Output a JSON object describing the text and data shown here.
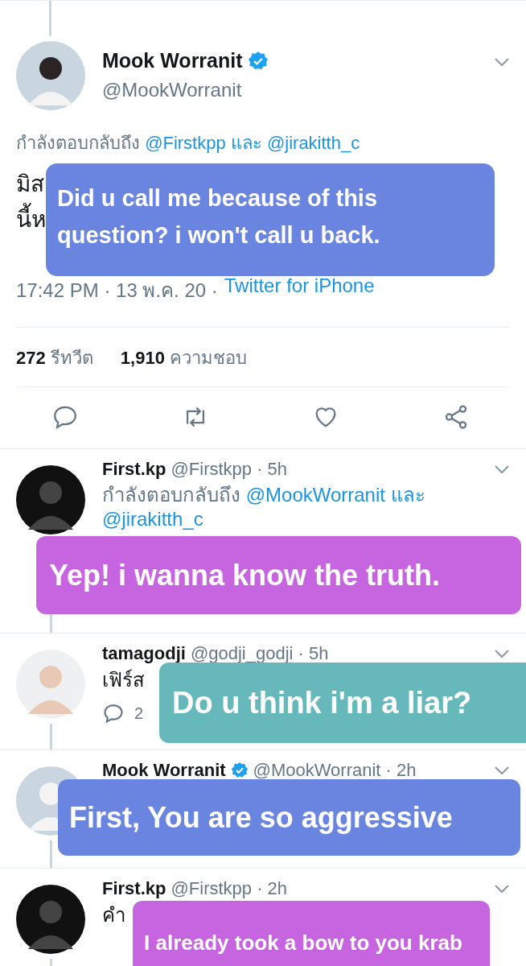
{
  "main_tweet": {
    "name": "Mook Worranit",
    "verified": true,
    "handle": "@MookWorranit",
    "reply_to": [
      {
        "kind": "plain",
        "text": "กำลังตอบกลับถึง"
      },
      {
        "kind": "mention",
        "text": "@Firstkpp"
      },
      {
        "kind": "mention",
        "text": "และ"
      },
      {
        "kind": "mention",
        "text": "@jirakitth_c"
      }
    ],
    "body_visible": [
      "มิส",
      "นี้ห"
    ],
    "timestamp": "17:42 PM · 13 พ.ค. 20 ·",
    "source": "Twitter for iPhone",
    "stats": [
      "**272** รีทวีต",
      "**1,910** ความชอบ"
    ],
    "caption": {
      "text": "Did u call me because of this question? i won't call u back.",
      "color": "#6a85e0"
    }
  },
  "replies": [
    {
      "name": "First.kp",
      "verified": false,
      "meta": "@Firstkpp · 5h",
      "reply_to": [
        {
          "kind": "plain",
          "text": "กำลังตอบกลับถึง"
        },
        {
          "kind": "mention",
          "text": "@MookWorranit"
        },
        {
          "kind": "mention",
          "text": "และ"
        },
        {
          "kind": "mention",
          "text": "@jirakitth_c"
        }
      ],
      "caption": {
        "text": "Yep! i wanna know the truth.",
        "color": "#c764e0"
      }
    },
    {
      "name": "tamagodji",
      "verified": false,
      "meta": "@godji_godji · 5h",
      "body": "เฟิร์ส",
      "actions": [
        {
          "kind": "reply",
          "count": "2"
        }
      ],
      "caption": {
        "text": "Do u think i'm a liar?",
        "color": "#66b8ba"
      }
    },
    {
      "name": "Mook Worranit",
      "verified": true,
      "meta": "@MookWorranit · 2h",
      "caption": {
        "text": "First, You are so aggressive",
        "color": "#6a85e0"
      }
    },
    {
      "name": "First.kp",
      "verified": false,
      "meta": "@Firstkpp · 2h",
      "body": "คำ",
      "caption": {
        "text": "I already took a bow to you krab",
        "color": "#c764e0"
      }
    }
  ]
}
